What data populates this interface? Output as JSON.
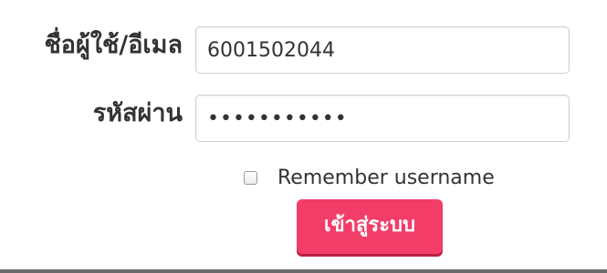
{
  "login_form": {
    "username_label": "ชื่อผู้ใช้/อีเมล",
    "username_value": "6001502044",
    "password_label": "รหัสผ่าน",
    "password_masked": "•••••••••••",
    "remember_label": "Remember username",
    "remember_checked": false,
    "submit_label": "เข้าสู่ระบบ"
  },
  "colors": {
    "submit_button": "#f23d69",
    "submit_button_shadow": "#b81e45",
    "text": "#333333",
    "input_border": "#cfcfcf"
  }
}
